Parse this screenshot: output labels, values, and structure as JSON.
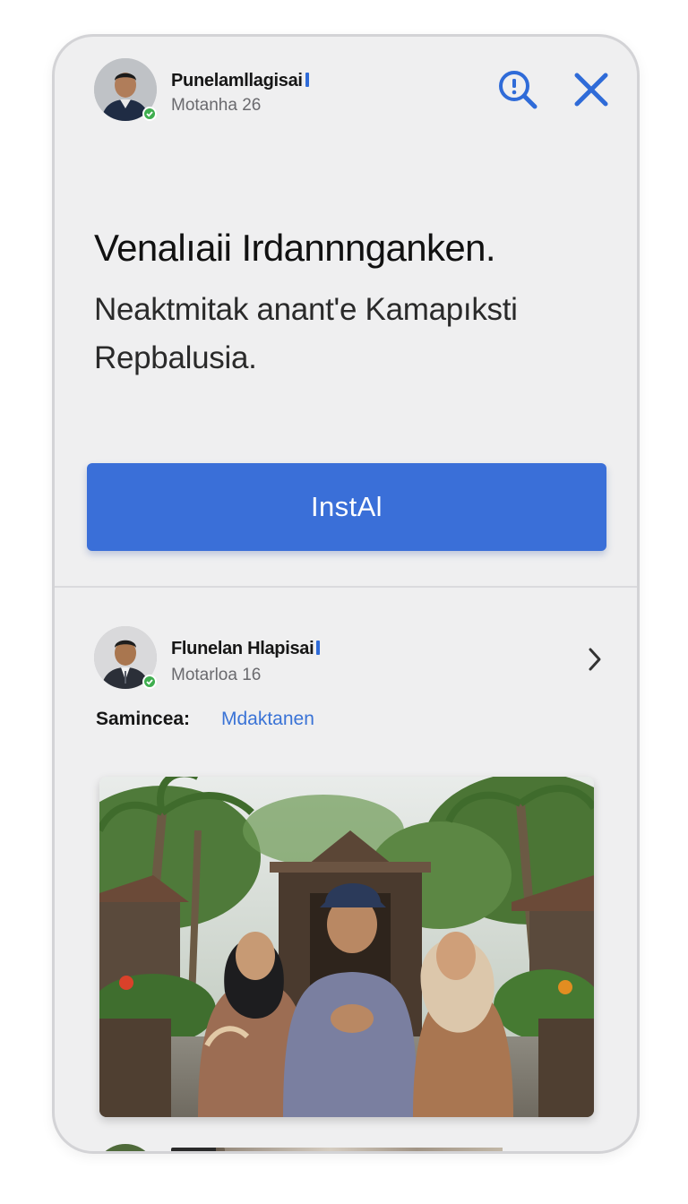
{
  "header": {
    "profile_name": "Punelamllagisai",
    "profile_meta": "Motanha  26",
    "search_icon": "search-info-icon",
    "close_icon": "close-icon"
  },
  "promo": {
    "headline": "Venalıaii Irdannnganken.",
    "subheadline": "Neaktmitak anant'e Kamapıksti Repbalusia."
  },
  "install_button": {
    "label": "InstAl",
    "color": "#3a6fd8"
  },
  "post": {
    "author_name": "Flunelan Hlapisai",
    "author_meta": "Motarloa  16",
    "chevron_icon": "chevron-right-icon",
    "field_label": "Samincea:",
    "field_value": "Mdaktanen"
  },
  "colors": {
    "accent": "#3a6fd8",
    "verified": "#3fae4f",
    "link": "#3a73d6"
  }
}
